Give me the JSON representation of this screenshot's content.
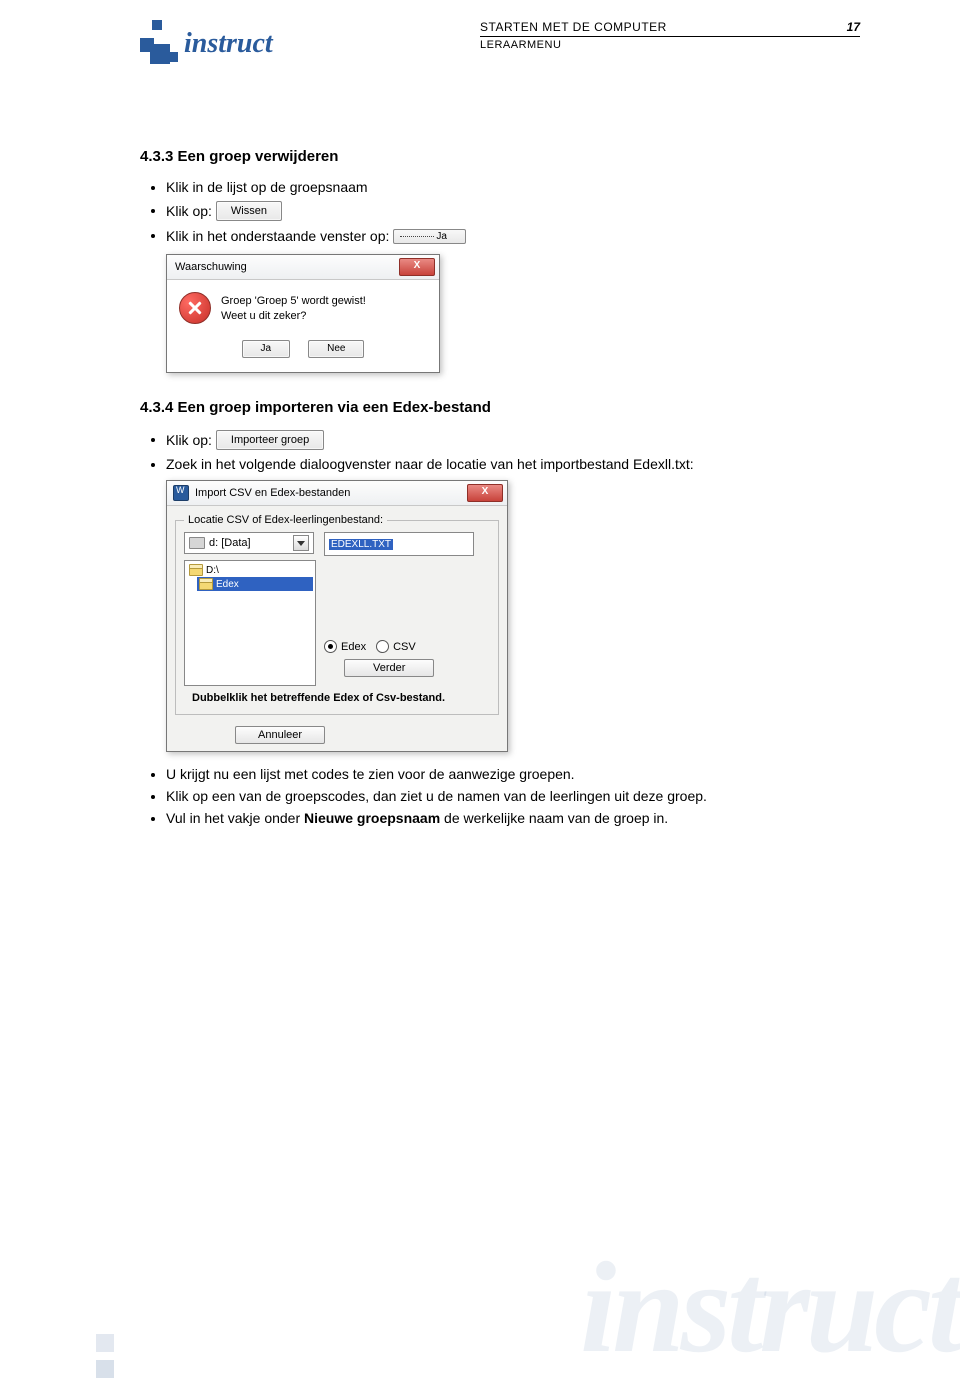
{
  "header": {
    "doc_title": "STARTEN MET DE COMPUTER",
    "page_number": "17",
    "subtitle": "LERAARMENU",
    "logo_text": "instruct"
  },
  "section_433": {
    "heading": "4.3.3 Een groep verwijderen",
    "bullets": {
      "b1": "Klik in de lijst op de groepsnaam",
      "b2_prefix": "Klik op:",
      "btn_wissen": "Wissen",
      "b3_prefix": "Klik in het onderstaande venster op:",
      "btn_ja_inline": "Ja"
    },
    "dialog": {
      "title": "Waarschuwing",
      "msg_line1": "Groep 'Groep 5' wordt gewist!",
      "msg_line2": "Weet u dit zeker?",
      "btn_ja": "Ja",
      "btn_nee": "Nee",
      "close": "X"
    }
  },
  "section_434": {
    "heading": "4.3.4 Een groep importeren via een Edex-bestand",
    "bullets": {
      "b1_prefix": "Klik op:",
      "btn_import": "Importeer groep",
      "b2": "Zoek in het volgende dialoogvenster naar de locatie van het importbestand Edexll.txt:"
    },
    "dialog": {
      "title": "Import CSV en Edex-bestanden",
      "legend": "Locatie CSV of Edex-leerlingenbestand:",
      "drive": "d: [Data]",
      "selected_file": "EDEXLL.TXT",
      "tree_root": "D:\\",
      "tree_sel": "Edex",
      "radio_edex": "Edex",
      "radio_csv": "CSV",
      "btn_verder": "Verder",
      "hint": "Dubbelklik het betreffende Edex of Csv-bestand.",
      "btn_annuleer": "Annuleer",
      "close": "X"
    },
    "after": {
      "b1": "U krijgt nu een lijst met codes te zien voor de aanwezige groepen.",
      "b2": "Klik op een van de groepscodes, dan ziet u de namen van de leerlingen uit deze groep.",
      "b3_pre": "Vul in het vakje onder ",
      "b3_bold": "Nieuwe groepsnaam",
      "b3_post": " de werkelijke naam van de groep in."
    }
  },
  "watermark": "instruct"
}
